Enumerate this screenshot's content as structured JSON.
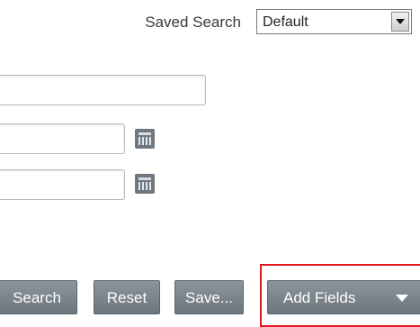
{
  "saved_search": {
    "label": "Saved Search",
    "selected": "Default"
  },
  "buttons": {
    "search": "Search",
    "reset": "Reset",
    "save": "Save...",
    "add_fields": "Add Fields"
  },
  "icons": {
    "calendar": "calendar-icon",
    "dropdown": "chevron-down-icon"
  },
  "colors": {
    "button_bg": "#7c868c",
    "highlight": "#e21b23"
  }
}
